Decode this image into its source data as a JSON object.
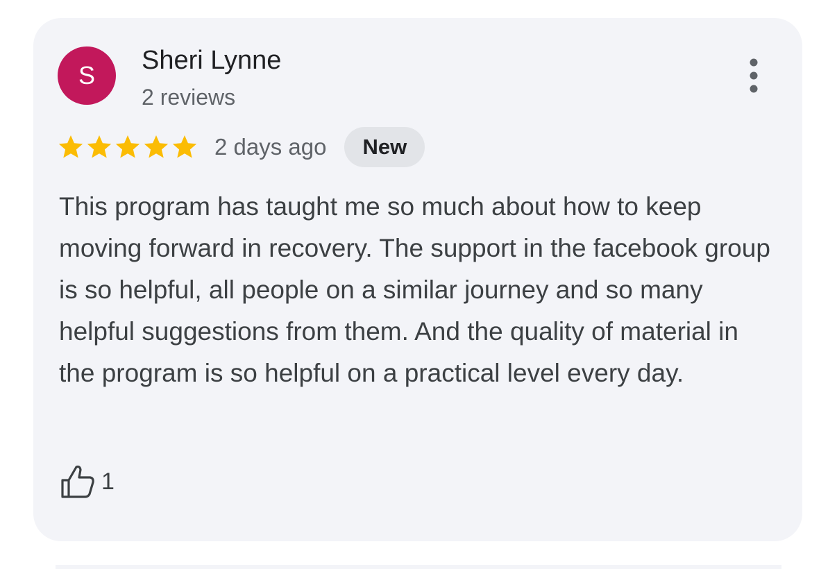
{
  "review": {
    "avatar_initial": "S",
    "avatar_color": "#c2185b",
    "reviewer_name": "Sheri Lynne",
    "review_count": "2 reviews",
    "rating": 5,
    "rating_max": 5,
    "star_color": "#fbbc04",
    "date": "2 days ago",
    "badge": "New",
    "text": "This program has taught me so much about how to keep moving forward in recovery. The support in the facebook group is so helpful, all people on a similar journey and so many helpful suggestions from them. And the quality of material in the program is so helpful on a practical level every day.",
    "like_count": "1",
    "icons": {
      "more": "more-vert-icon",
      "like": "thumb-up-icon",
      "star": "star-icon"
    }
  }
}
